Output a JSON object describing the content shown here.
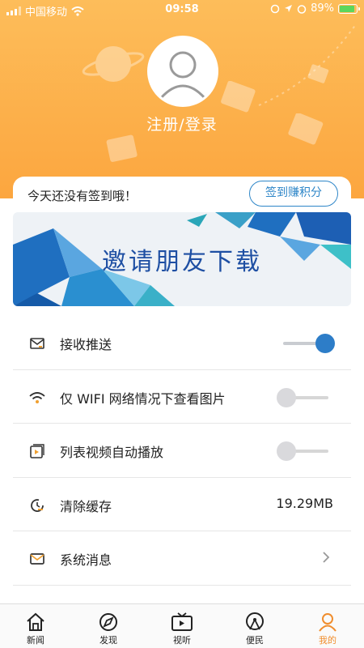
{
  "status_bar": {
    "carrier": "中国移动",
    "time": "09:58",
    "battery": "89%"
  },
  "profile": {
    "login_label": "注册/登录"
  },
  "signin": {
    "message": "今天还没有签到哦！",
    "button_label": "签到赚积分"
  },
  "banner": {
    "title": "邀请朋友下载"
  },
  "settings": [
    {
      "label": "接收推送",
      "icon": "push-message-icon",
      "control": "toggle",
      "on": true
    },
    {
      "label": "仅 WIFI 网络情况下查看图片",
      "icon": "wifi-icon",
      "control": "toggle",
      "on": false
    },
    {
      "label": "列表视频自动播放",
      "icon": "video-play-icon",
      "control": "toggle",
      "on": false
    },
    {
      "label": "清除缓存",
      "icon": "clear-cache-icon",
      "control": "value",
      "value": "19.29MB"
    },
    {
      "label": "系统消息",
      "icon": "mail-icon",
      "control": "chevron"
    }
  ],
  "tabs": [
    {
      "label": "新闻",
      "icon": "home-icon",
      "active": false
    },
    {
      "label": "发现",
      "icon": "compass-icon",
      "active": false
    },
    {
      "label": "视听",
      "icon": "tv-icon",
      "active": false
    },
    {
      "label": "便民",
      "icon": "service-icon",
      "active": false
    },
    {
      "label": "我的",
      "icon": "person-icon",
      "active": true
    }
  ],
  "colors": {
    "header_top": "#fdbd5a",
    "header_bottom": "#fca63f",
    "accent_blue": "#2d7dc8",
    "active_tab": "#f08d2d"
  }
}
